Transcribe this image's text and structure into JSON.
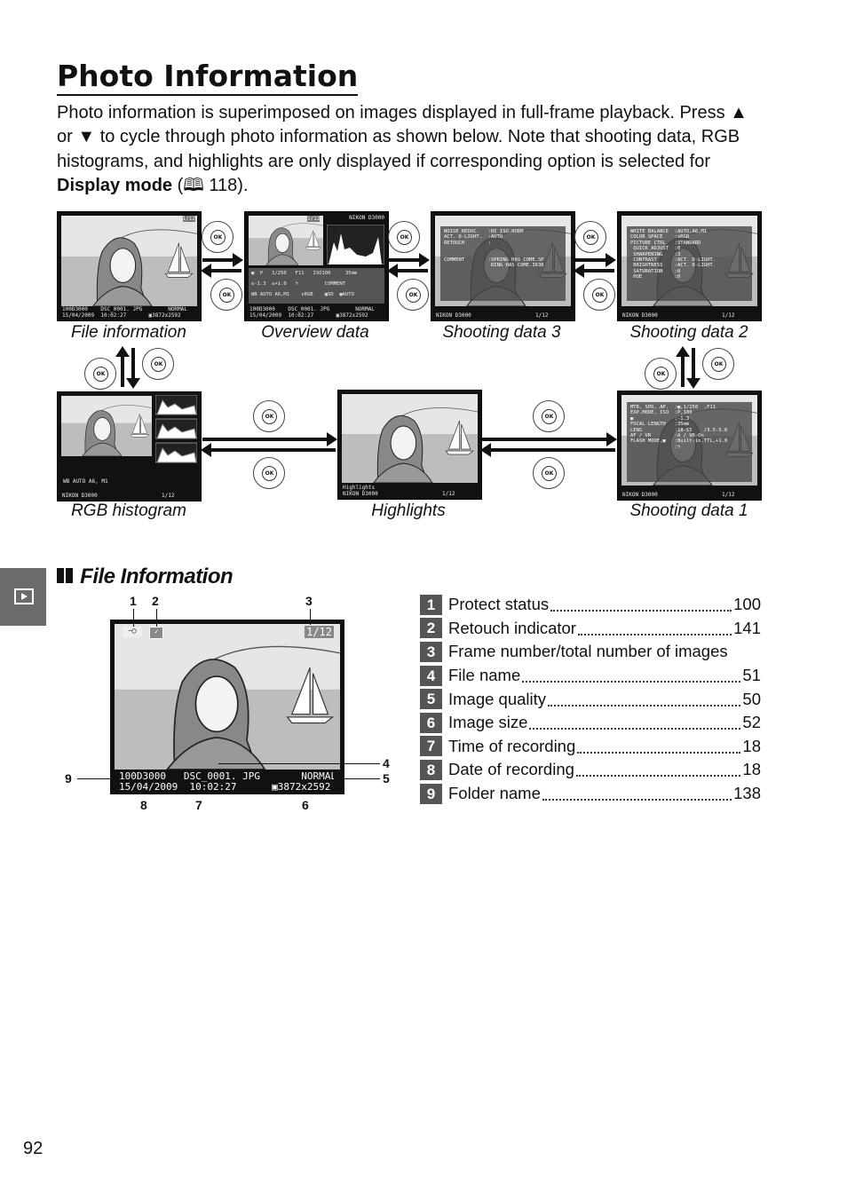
{
  "title": "Photo Information",
  "intro": {
    "p1": "Photo information is superimposed on images displayed in full-frame playback. Press ▲ or ▼ to cycle through photo information as shown below.  Note that shooting data, RGB histograms, and highlights are only displayed if corresponding option is selected for ",
    "bold": "Display mode",
    "p2": " (",
    "book_icon": "book-icon",
    "p3": " 118)."
  },
  "screens": {
    "file_info": {
      "caption": "File information",
      "frame": "1/12",
      "foot1": "100D3000    DSC_0001. JPG        NORMAL",
      "foot2": "15/04/2009  10:02:27       ▣3872x2592"
    },
    "overview": {
      "caption": "Overview data",
      "frame": "1/12",
      "camera": "NIKON D3000",
      "rows": "▣  P   1/250   F11   ISO100     35mm\n☒-1.3  ☒+1.0   ϟ         COMMENT\nWB AUTO A6,M1    sRGB    ▣SD  ▣AUTO",
      "foot1": "100D3000    DSC_0001. JPG        NORMAL",
      "foot2": "15/04/2009  10:02:27       ▣3872x2592"
    },
    "shooting3": {
      "caption": "Shooting data 3",
      "overlay": "NOISE REDUC.   :HI ISO,NORM\nACT. D-LIGHT.  :AUTO\nRETOUCH        :\n\n\nCOMMENT        :SPRING HAS COME.SP\n                RING HAS COME.3636",
      "foot": "NIKON D3000                    1/12"
    },
    "shooting2": {
      "caption": "Shooting data 2",
      "overlay": "WHITE BALANCE  :AUTO,A6,M1\nCOLOR SPACE    :sRGB\nPICTURE CTRL   :STANDARD\n QUICK ADJUST  :0\n SHARPENING    :3\n CONTRAST      :ACT. D-LIGHT.\n BRIGHTNESS    :ACT. D-LIGHT.\n SATURATION    :0\n HUE           :0",
      "foot": "NIKON D3000                    1/12"
    },
    "rgb": {
      "caption": "RGB histogram",
      "wb": "WB AUTO A6, M1",
      "foot": "NIKON D3000                    1/12"
    },
    "highlights": {
      "caption": "Highlights",
      "foot": "Highlights\nNIKON D3000                    1/12"
    },
    "shooting1": {
      "caption": "Shooting data 1",
      "overlay": "MTR, SPD, AP.  :▣,1/250  ,F11\nEXP.MODE, ISO  :P,100\n▣              :-1.3\nFOCAL LENGTH   :35mm\nLENS           :18-55    /3.5-5.6\nAF / VR        :A / VR-On\nFLASH MODE,▣   :Built-in,TTL,+1.0\n               :ϟ",
      "foot": "NIKON D3000                    1/12"
    }
  },
  "section": {
    "title": "File Information",
    "tab_icon": "playback-icon"
  },
  "diagram": {
    "frame": "1/12",
    "foot1": "100D3000   DSC_0001. JPG       NORMAL",
    "foot2": "15/04/2009  10:02:27      ▣3872x2592",
    "callouts": [
      "1",
      "2",
      "3",
      "4",
      "5",
      "6",
      "7",
      "8",
      "9"
    ]
  },
  "items": [
    {
      "n": "1",
      "label": "Protect status",
      "page": "100"
    },
    {
      "n": "2",
      "label": "Retouch indicator",
      "page": "141"
    },
    {
      "n": "3",
      "label": "Frame number/total number of images",
      "page": ""
    },
    {
      "n": "4",
      "label": "File name",
      "page": "51"
    },
    {
      "n": "5",
      "label": "Image quality",
      "page": "50"
    },
    {
      "n": "6",
      "label": "Image size",
      "page": "52"
    },
    {
      "n": "7",
      "label": "Time of recording",
      "page": "18"
    },
    {
      "n": "8",
      "label": "Date of recording",
      "page": "18"
    },
    {
      "n": "9",
      "label": "Folder name",
      "page": "138"
    }
  ],
  "page_number": "92"
}
